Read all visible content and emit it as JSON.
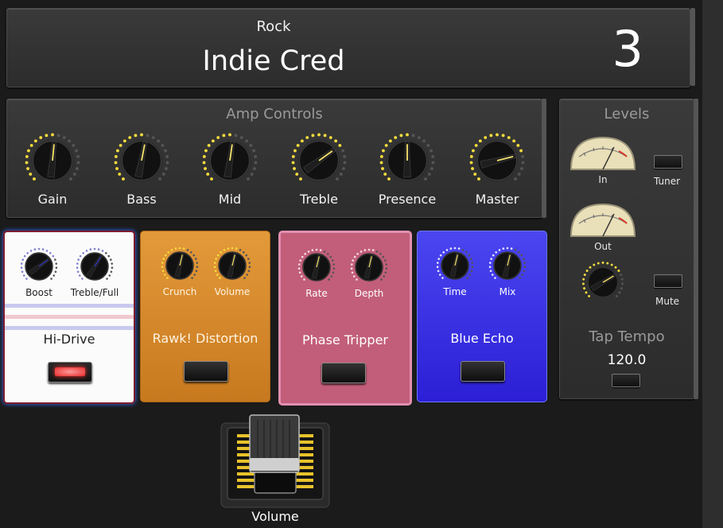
{
  "header": {
    "category": "Rock",
    "preset_name": "Indie Cred",
    "preset_number": "3"
  },
  "amp": {
    "title": "Amp Controls",
    "knobs": [
      {
        "label": "Gain",
        "value": 0.52
      },
      {
        "label": "Bass",
        "value": 0.54
      },
      {
        "label": "Mid",
        "value": 0.53
      },
      {
        "label": "Treble",
        "value": 0.7
      },
      {
        "label": "Presence",
        "value": 0.5
      },
      {
        "label": "Master",
        "value": 0.78
      }
    ]
  },
  "levels": {
    "title": "Levels",
    "in_label": "In",
    "out_label": "Out",
    "tuner_label": "Tuner",
    "mute_label": "Mute",
    "tap_tempo_label": "Tap Tempo",
    "tempo_value": "120.0"
  },
  "pedals": [
    {
      "name": "Hi-Drive",
      "knobs": [
        "Boost",
        "Treble/Full"
      ],
      "active": true
    },
    {
      "name": "Rawk! Distortion",
      "knobs": [
        "Crunch",
        "Volume"
      ],
      "active": false
    },
    {
      "name": "Phase Tripper",
      "knobs": [
        "Rate",
        "Depth"
      ],
      "active": false
    },
    {
      "name": "Blue Echo",
      "knobs": [
        "Time",
        "Mix"
      ],
      "active": false
    }
  ],
  "volume_pedal": {
    "label": "Volume"
  },
  "colors": {
    "ring_active": "#f7dc3c",
    "ring_inactive": "#555555",
    "led_on": "#ff4a4a"
  }
}
